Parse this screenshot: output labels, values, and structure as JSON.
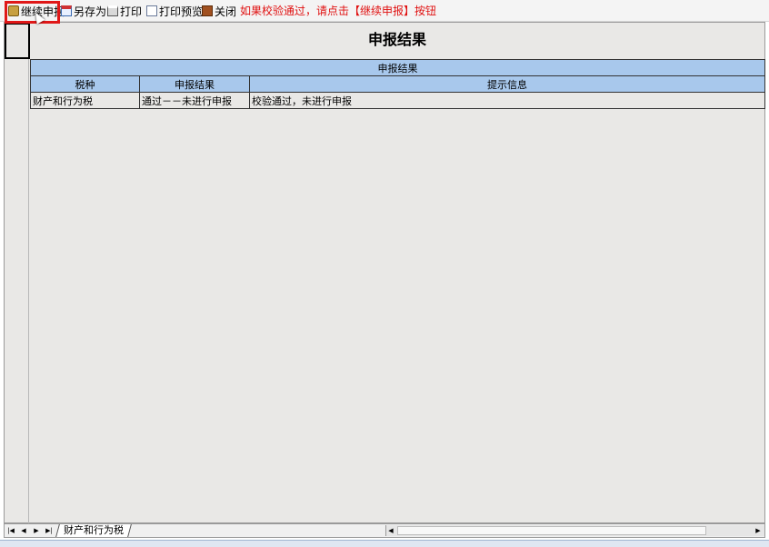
{
  "toolbar": {
    "continue_label": "继续申报",
    "saveas_label": "另存为",
    "print_label": "打印",
    "preview_label": "打印预览",
    "close_label": "关闭",
    "hint": "如果校验通过，请点击【继续申报】按钮"
  },
  "report": {
    "title": "申报结果",
    "group_header": "申报结果",
    "columns": [
      "税种",
      "申报结果",
      "提示信息"
    ],
    "rows": [
      [
        "财产和行为税",
        "通过－－未进行申报",
        "校验通过，未进行申报"
      ]
    ]
  },
  "sheet_tabs": [
    "财产和行为税"
  ],
  "colors": {
    "header_bg": "#a8c8ec",
    "hint_red": "#e01010",
    "highlight_red": "#e01818",
    "sheet_bg": "#e9e8e6"
  },
  "icons": {
    "continue": "continue-declare-icon",
    "saveas": "save-as-icon",
    "print": "printer-icon",
    "preview": "print-preview-icon",
    "close": "close-door-icon"
  }
}
